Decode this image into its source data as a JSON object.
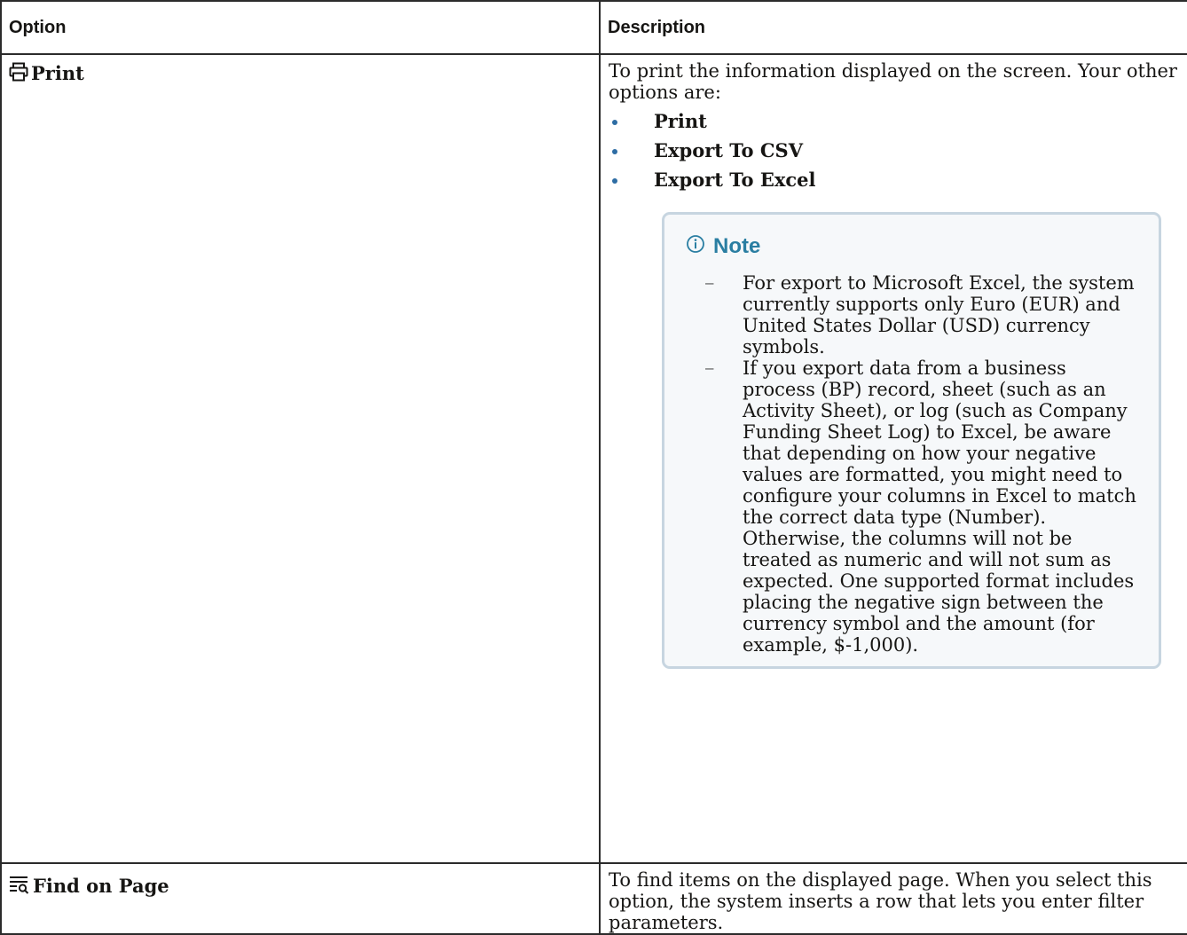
{
  "table": {
    "headers": {
      "option": "Option",
      "description": "Description"
    },
    "rows": [
      {
        "icon": "printer-icon",
        "label": "Print",
        "description": "To print the information displayed on the screen. Your other options are:",
        "bullets": [
          "Print",
          "Export To CSV",
          "Export To Excel"
        ],
        "note": {
          "icon": "info-icon",
          "title": "Note",
          "items": [
            "For export to Microsoft Excel, the system currently supports only Euro (EUR) and United States Dollar (USD) currency symbols.",
            "If you export data from a business process (BP) record, sheet (such as an Activity Sheet), or log (such as Company Funding Sheet Log) to Excel, be aware that depending on how your negative values are formatted, you might need to configure your columns in Excel to match the correct data type (Number). Otherwise, the columns will not be treated as numeric and will not sum as expected. One supported format includes placing the negative sign between the currency symbol and the amount (for example, $-1,000)."
          ]
        }
      },
      {
        "icon": "find-on-page-icon",
        "label": "Find on Page",
        "description": "To find items on the displayed page. When you select this option, the system inserts a row that lets you enter filter parameters."
      }
    ]
  },
  "colors": {
    "note_title": "#2a7ea2",
    "note_border": "#c7d5e0",
    "bullet": "#2e6da4"
  }
}
